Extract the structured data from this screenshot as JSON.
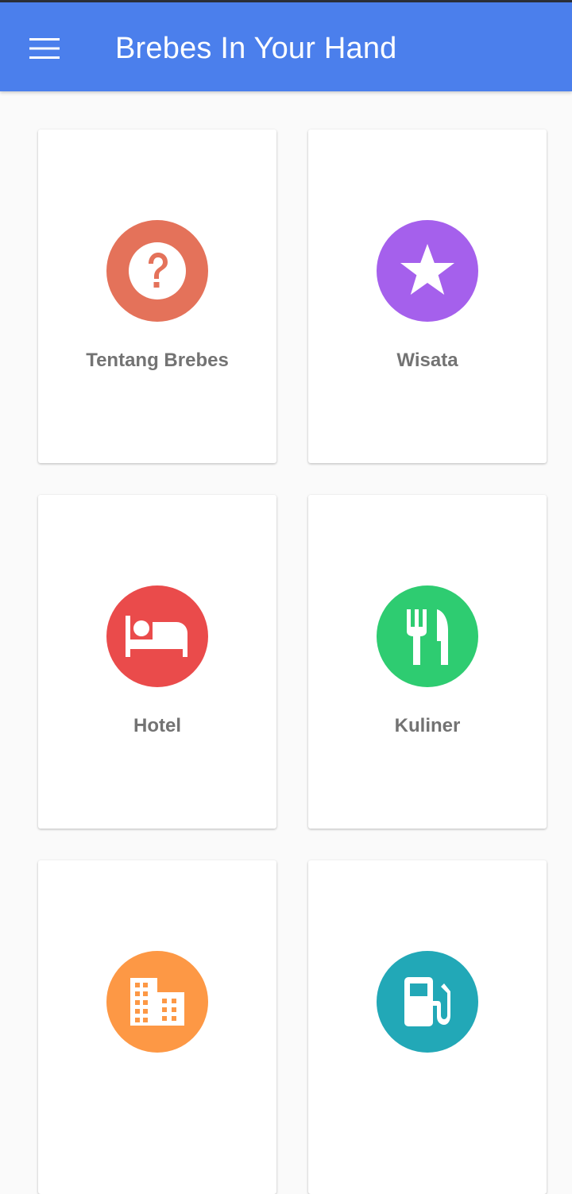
{
  "app_bar": {
    "title": "Brebes In Your Hand",
    "color": "#4b7fec",
    "menu_icon": "hamburger-menu-icon"
  },
  "menu_items": [
    {
      "label": "Tentang Brebes",
      "icon": "help-circle-icon",
      "color": "#e4725a"
    },
    {
      "label": "Wisata",
      "icon": "star-icon",
      "color": "#a560ec"
    },
    {
      "label": "Hotel",
      "icon": "hotel-bed-icon",
      "color": "#ea4b4b"
    },
    {
      "label": "Kuliner",
      "icon": "restaurant-icon",
      "color": "#2ecc71"
    },
    {
      "label": "",
      "icon": "office-building-icon",
      "color": "#fd9845"
    },
    {
      "label": "",
      "icon": "gas-station-icon",
      "color": "#22a8b7"
    }
  ]
}
